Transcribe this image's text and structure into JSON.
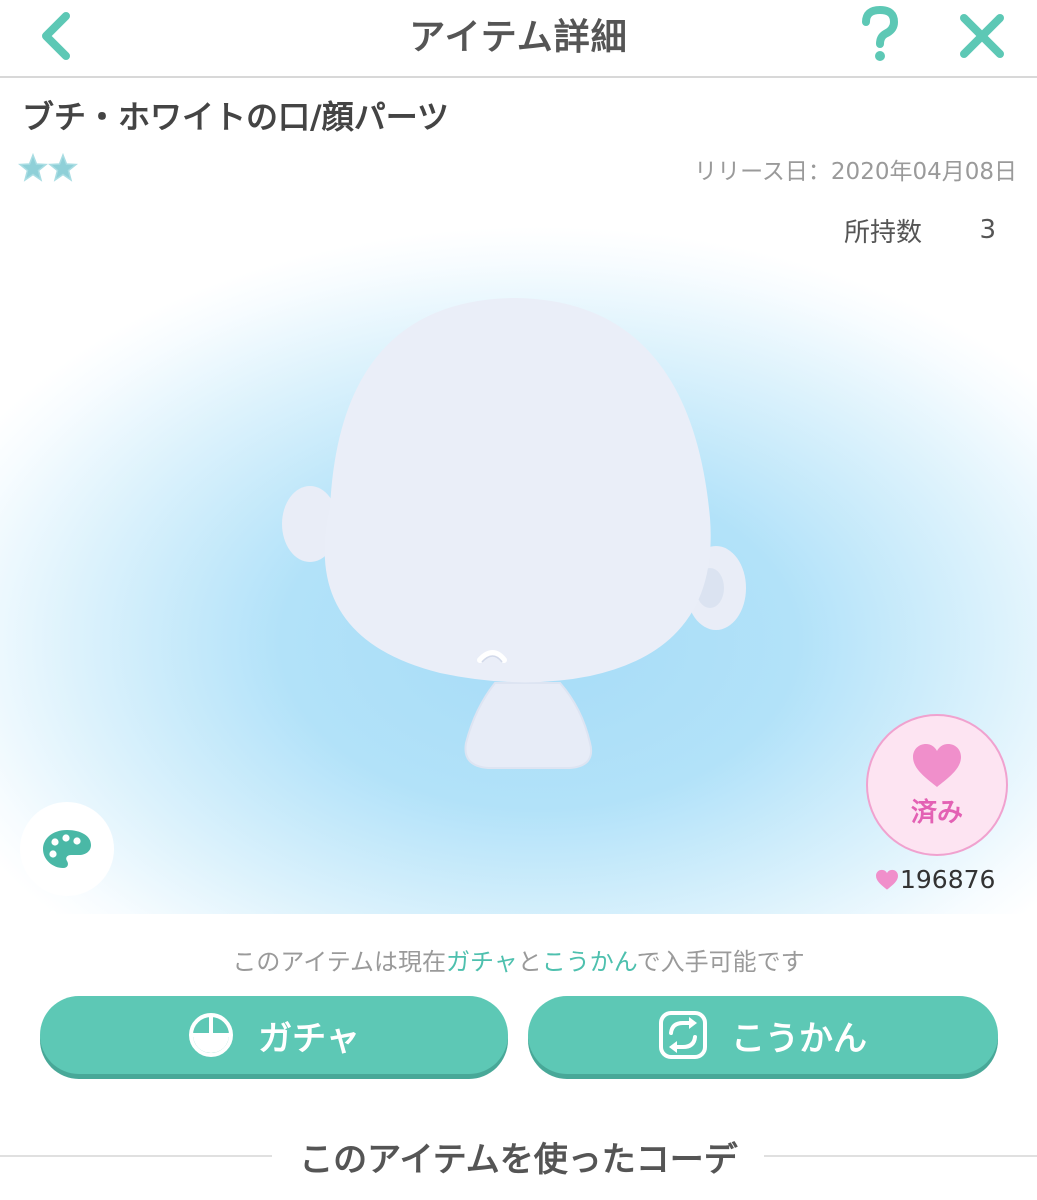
{
  "header": {
    "title": "アイテム詳細",
    "back_icon": "chevron-left-icon",
    "help_icon": "question-mark-icon",
    "close_icon": "close-icon",
    "accent_color": "#5dc8b5"
  },
  "item": {
    "name": "ブチ・ホワイトの口/顔パーツ",
    "rarity_stars": 2,
    "release_date": "リリース日：2020年04月08日"
  },
  "preview": {
    "owned_label": "所持数",
    "owned_count": "3",
    "palette_icon": "palette-icon",
    "like": {
      "icon": "heart-icon",
      "status": "済み",
      "count": "196876",
      "color": "#e361b4"
    }
  },
  "availability": {
    "prefix": "このアイテムは現在",
    "gacha": "ガチャ",
    "and": "と",
    "exchange": "こうかん",
    "suffix": "で入手可能です"
  },
  "buttons": {
    "gacha_label": "ガチャ",
    "gacha_icon": "gacha-icon",
    "exchange_label": "こうかん",
    "exchange_icon": "exchange-icon"
  },
  "coordinates_section": {
    "title": "このアイテムを使ったコーデ"
  }
}
